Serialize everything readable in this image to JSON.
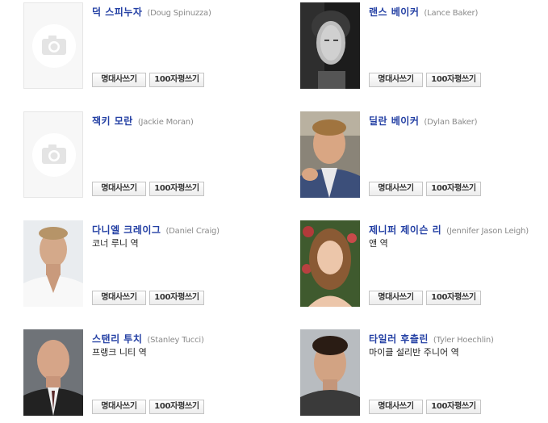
{
  "buttons": {
    "quote": "명대사쓰기",
    "review": "100자평쓰기"
  },
  "cast": [
    {
      "name_ko": "덕 스피누자",
      "name_en": "(Doug Spinuzza)",
      "role": ""
    },
    {
      "name_ko": "랜스 베이커",
      "name_en": "(Lance Baker)",
      "role": ""
    },
    {
      "name_ko": "잭키 모란",
      "name_en": "(Jackie Moran)",
      "role": ""
    },
    {
      "name_ko": "딜란 베이커",
      "name_en": "(Dylan Baker)",
      "role": ""
    },
    {
      "name_ko": "다니엘 크레이그",
      "name_en": "(Daniel Craig)",
      "role": "코너 루니 역"
    },
    {
      "name_ko": "제니퍼 제이슨 리",
      "name_en": "(Jennifer Jason Leigh)",
      "role": "앤 역"
    },
    {
      "name_ko": "스탠리 투치",
      "name_en": "(Stanley Tucci)",
      "role": "프랭크 니티 역"
    },
    {
      "name_ko": "타일러 후츨린",
      "name_en": "(Tyler Hoechlin)",
      "role": "마이클 설리반 주니어 역"
    }
  ]
}
